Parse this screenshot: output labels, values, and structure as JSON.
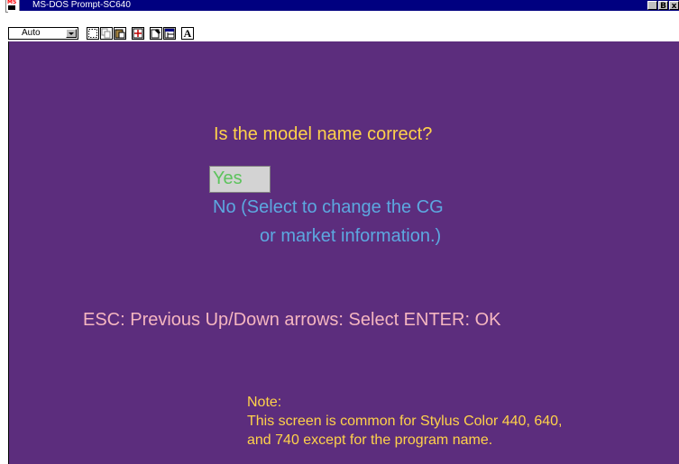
{
  "window": {
    "title": "MS-DOS Prompt-SC640",
    "app_icon_text": "MS",
    "caption_buttons": {
      "minimize": "_",
      "maximize": "B",
      "close": "x"
    }
  },
  "toolbar": {
    "font_size_value": "Auto",
    "buttons": [
      "mark-icon",
      "copy-icon",
      "paste-icon",
      "full-screen-icon",
      "properties-icon",
      "background-icon",
      "font-icon"
    ],
    "font_button_label": "A"
  },
  "screen": {
    "background_color": "#5c2d7d",
    "question": "Is the model name correct?",
    "options": {
      "yes": "Yes",
      "no_line1": "No (Select to change the CG",
      "no_line2": "or market information.)"
    },
    "key_help": "ESC: Previous  Up/Down arrows: Select  ENTER: OK",
    "note": {
      "heading": "Note:",
      "line1": "This screen is common for Stylus Color 440, 640,",
      "line2": "and 740 except for the program name."
    }
  }
}
